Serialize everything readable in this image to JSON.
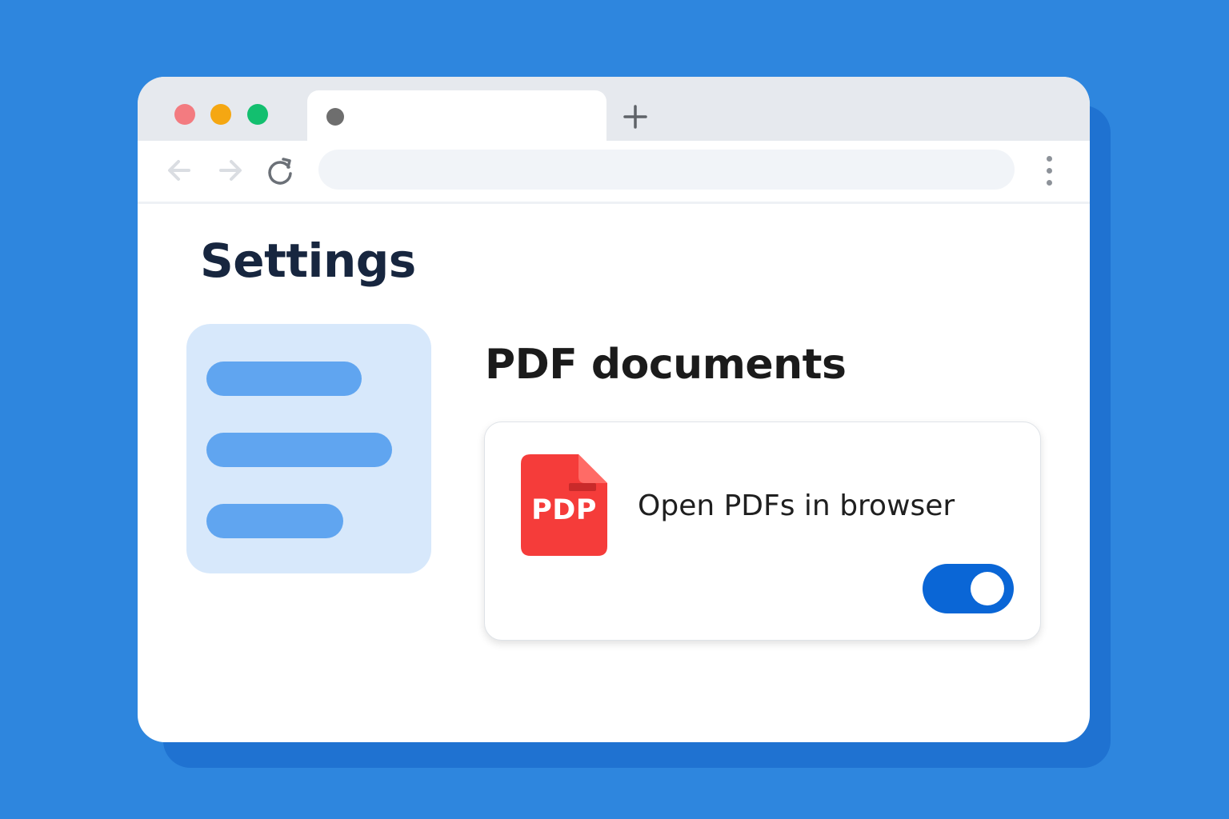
{
  "colors": {
    "background": "#2e86de",
    "accent": "#0a66d6",
    "pdf_icon": "#f53c3a",
    "sidebar": "#d7e8fb",
    "sidebar_pill": "#60a5f0"
  },
  "browser": {
    "window_controls": [
      "close",
      "minimize",
      "maximize"
    ],
    "tab": {
      "favicon": "dot-icon"
    },
    "new_tab_icon": "plus-icon",
    "toolbar": {
      "back_icon": "arrow-left-icon",
      "forward_icon": "arrow-right-icon",
      "reload_icon": "reload-icon",
      "address_value": "",
      "menu_icon": "vertical-dots-icon"
    }
  },
  "page": {
    "title": "Settings",
    "section_title": "PDF documents",
    "setting": {
      "icon": "pdf-file-icon",
      "icon_text": "PDP",
      "label": "Open PDFs in browser",
      "toggle_on": true
    }
  }
}
